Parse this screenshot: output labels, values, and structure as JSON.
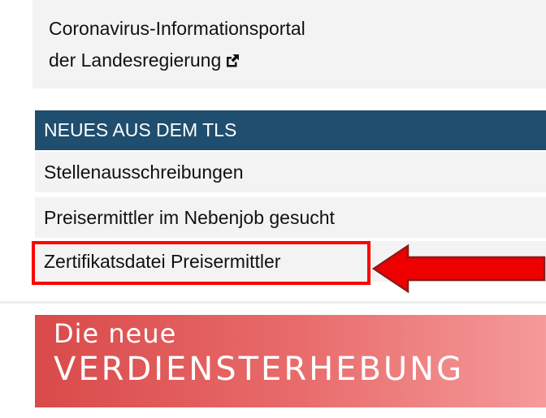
{
  "portal": {
    "line1": "Coronavirus-Informationsportal",
    "line2": "der Landesregierung",
    "icon": "external-link-icon"
  },
  "news": {
    "header": "NEUES AUS DEM TLS",
    "items": [
      {
        "label": "Stellenausschreibungen"
      },
      {
        "label": "Preisermittler im Nebenjob gesucht"
      },
      {
        "label": "Zertifikatsdatei Preisermittler"
      }
    ]
  },
  "annotation": {
    "box_color": "#ff0000",
    "arrow_color": "#ee0000",
    "arrow_icon": "arrow-left-icon"
  },
  "banner": {
    "line1": "Die neue",
    "line2": "VERDIENSTERHEBUNG"
  },
  "colors": {
    "header_bg": "#1f4e6e",
    "item_bg": "#f3f3f3",
    "banner_start": "#d94a4a",
    "banner_end": "#f59a9a"
  }
}
